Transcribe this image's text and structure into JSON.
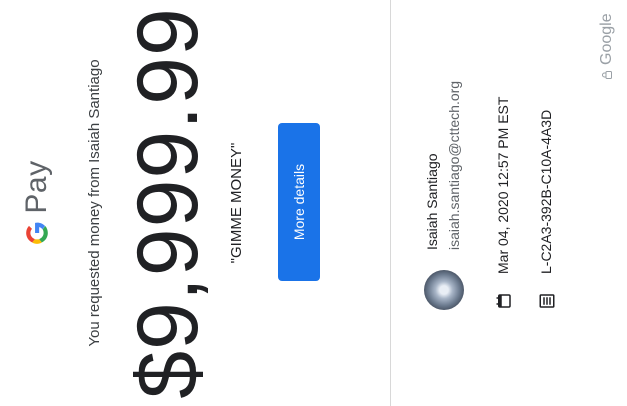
{
  "brand": {
    "pay_label": "Pay"
  },
  "request": {
    "message": "You requested money from Isaiah Santiago",
    "amount": "$9,999.99",
    "note": "\"GIMME MONEY\""
  },
  "actions": {
    "more_details": "More details"
  },
  "contact": {
    "name": "Isaiah Santiago",
    "email": "isaiah.santiago@cttech.org"
  },
  "details": {
    "date": "Mar 04, 2020 12:57 PM EST",
    "transaction_id": "L-C2A3-392B-C10A-4A3D"
  },
  "footer": {
    "google_label": "Google"
  },
  "colors": {
    "accent": "#1a73e8"
  }
}
